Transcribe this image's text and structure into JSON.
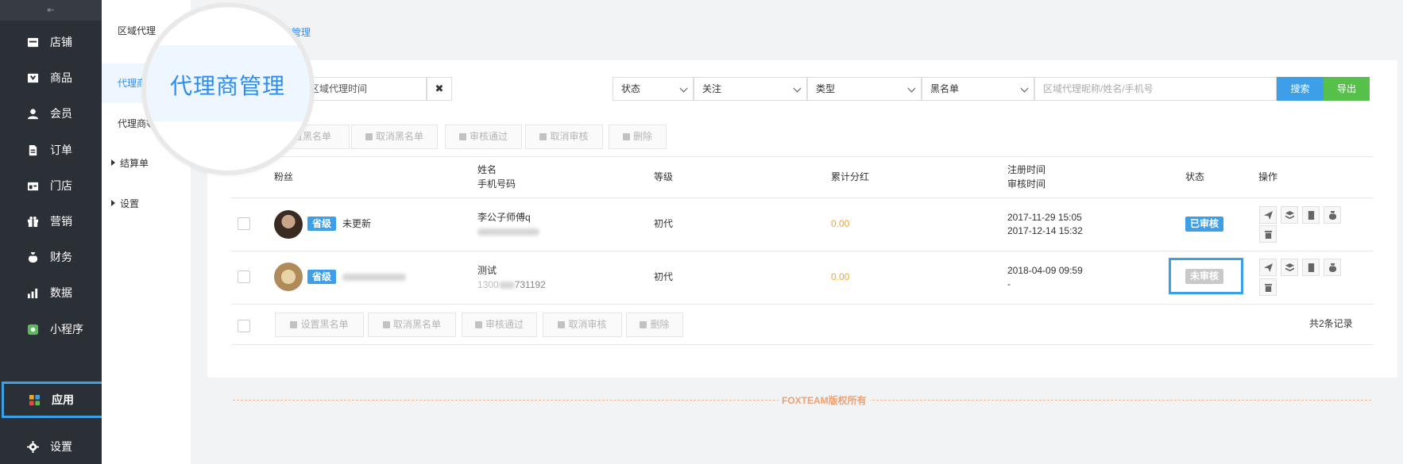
{
  "sidebar": {
    "collapse_glyph": "⇤",
    "items": [
      {
        "label": "店铺",
        "icon": "store-icon"
      },
      {
        "label": "商品",
        "icon": "product-icon"
      },
      {
        "label": "会员",
        "icon": "member-icon"
      },
      {
        "label": "订单",
        "icon": "order-icon"
      },
      {
        "label": "门店",
        "icon": "shop-icon"
      },
      {
        "label": "营销",
        "icon": "gift-icon"
      },
      {
        "label": "财务",
        "icon": "money-bag-icon"
      },
      {
        "label": "数据",
        "icon": "chart-icon"
      },
      {
        "label": "小程序",
        "icon": "miniprogram-icon"
      },
      {
        "label": "应用",
        "icon": "apps-icon",
        "active": true
      },
      {
        "label": "设置",
        "icon": "gear-icon"
      }
    ]
  },
  "subnav": {
    "title": "区域代理",
    "items": [
      {
        "label": "代理商",
        "active": true
      },
      {
        "label": "代理商等"
      },
      {
        "label": "结算单",
        "group": true
      },
      {
        "label": "设置",
        "group": true
      }
    ]
  },
  "breadcrumb": "商管理",
  "lens": {
    "label": "代理商管理"
  },
  "filters": {
    "date_label": "区域代理时间",
    "clear_glyph": "✖",
    "status": "状态",
    "follow": "关注",
    "type": "类型",
    "blacklist": "黑名单",
    "keyword_placeholder": "区域代理昵称/姓名/手机号",
    "search": "搜索",
    "export": "导出"
  },
  "bulk_actions": {
    "set_blacklist_top": "置黑名单",
    "set_blacklist": "设置黑名单",
    "cancel_blacklist": "取消黑名单",
    "approve": "审核通过",
    "cancel_approve": "取消审核",
    "delete": "删除"
  },
  "table": {
    "headers": {
      "fans": "粉丝",
      "name": "姓名",
      "phone": "手机号码",
      "level": "等级",
      "dividend": "累计分红",
      "reg_time": "注册时间",
      "audit_time": "审核时间",
      "status": "状态",
      "ops": "操作"
    },
    "rows": [
      {
        "tag": "省级",
        "nickname": "未更新",
        "name": "李公子师傅q",
        "level": "初代",
        "dividend": "0.00",
        "reg_time": "2017-11-29 15:05",
        "audit_time": "2017-12-14 15:32",
        "status": "已审核"
      },
      {
        "tag": "省级",
        "nickname": "",
        "name": "测试",
        "phone_partial": "1300",
        "phone_partial2": "731192",
        "level": "初代",
        "dividend": "0.00",
        "reg_time": "2018-04-09 09:59",
        "audit_time": "-",
        "status": "未审核"
      }
    ],
    "total": "共2条记录"
  },
  "footer": "FOXTEAM版权所有",
  "colors": {
    "sidebar_bg": "#2b2f36",
    "primary": "#3c9fe8",
    "success": "#56c04a",
    "money": "#f5a623"
  }
}
